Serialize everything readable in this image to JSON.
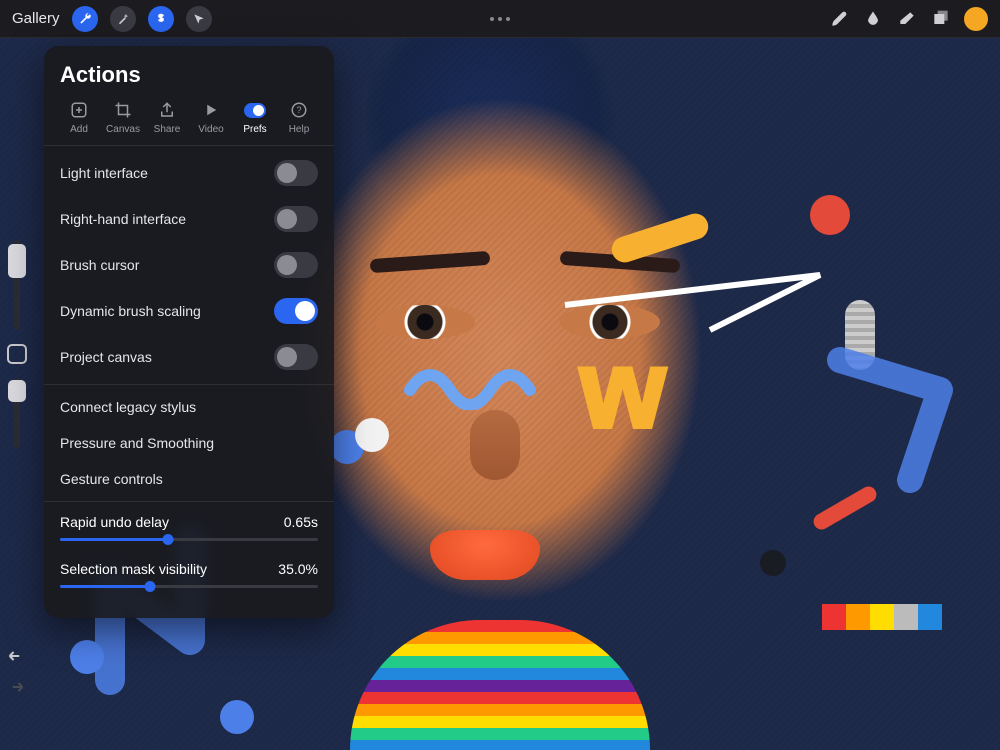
{
  "app": {
    "gallery_label": "Gallery"
  },
  "panel": {
    "title": "Actions",
    "tabs": [
      {
        "id": "add",
        "label": "Add"
      },
      {
        "id": "canvas",
        "label": "Canvas"
      },
      {
        "id": "share",
        "label": "Share"
      },
      {
        "id": "video",
        "label": "Video"
      },
      {
        "id": "prefs",
        "label": "Prefs"
      },
      {
        "id": "help",
        "label": "Help"
      }
    ],
    "active_tab": "prefs",
    "toggles": [
      {
        "id": "light-interface",
        "label": "Light interface",
        "on": false
      },
      {
        "id": "right-hand",
        "label": "Right-hand interface",
        "on": false
      },
      {
        "id": "brush-cursor",
        "label": "Brush cursor",
        "on": false
      },
      {
        "id": "dynamic-brush-scaling",
        "label": "Dynamic brush scaling",
        "on": true
      },
      {
        "id": "project-canvas",
        "label": "Project canvas",
        "on": false
      }
    ],
    "links": [
      {
        "id": "legacy-stylus",
        "label": "Connect legacy stylus"
      },
      {
        "id": "pressure-smoothing",
        "label": "Pressure and Smoothing"
      },
      {
        "id": "gesture-controls",
        "label": "Gesture controls"
      }
    ],
    "sliders": [
      {
        "id": "rapid-undo",
        "label": "Rapid undo delay",
        "value_text": "0.65s",
        "pct": 42
      },
      {
        "id": "mask-visibility",
        "label": "Selection mask visibility",
        "value_text": "35.0%",
        "pct": 35
      }
    ]
  },
  "colors": {
    "accent": "#2a66f0",
    "swatch": "#f5a623"
  }
}
